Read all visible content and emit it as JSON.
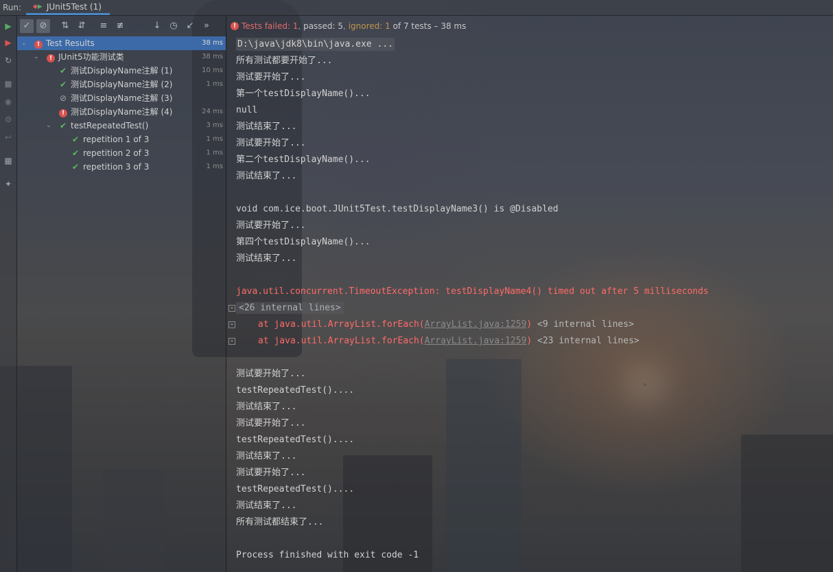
{
  "run_label": "Run:",
  "run_tab": {
    "label": "JUnit5Test (1)"
  },
  "status": {
    "failed": "Tests failed: 1",
    "passed": "passed: 5",
    "ignored": "ignored: 1",
    "summary": "of 7 tests – 38 ms"
  },
  "tree": [
    {
      "label": "Test Results",
      "duration": "38 ms",
      "status": "failed"
    },
    {
      "label": "JUnit5功能测试类",
      "duration": "38 ms",
      "status": "failed"
    },
    {
      "label": "测试DisplayName注解 (1)",
      "duration": "10 ms",
      "status": "passed"
    },
    {
      "label": "测试DisplayName注解 (2)",
      "duration": "1 ms",
      "status": "passed"
    },
    {
      "label": "测试DisplayName注解 (3)",
      "duration": "",
      "status": "ignored"
    },
    {
      "label": "测试DisplayName注解 (4)",
      "duration": "24 ms",
      "status": "failed"
    },
    {
      "label": "testRepeatedTest()",
      "duration": "3 ms",
      "status": "passed"
    },
    {
      "label": "repetition 1 of 3",
      "duration": "1 ms",
      "status": "passed"
    },
    {
      "label": "repetition 2 of 3",
      "duration": "1 ms",
      "status": "passed"
    },
    {
      "label": "repetition 3 of 3",
      "duration": "1 ms",
      "status": "passed"
    }
  ],
  "console": {
    "lines": [
      "D:\\java\\jdk8\\bin\\java.exe ...",
      "所有测试都要开始了...",
      "测试要开始了...",
      "第一个testDisplayName()...",
      "null",
      "测试结束了...",
      "测试要开始了...",
      "第二个testDisplayName()...",
      "测试结束了...",
      "",
      "void com.ice.boot.JUnit5Test.testDisplayName3() is @Disabled",
      "测试要开始了...",
      "第四个testDisplayName()...",
      "测试结束了...",
      "",
      "java.util.concurrent.TimeoutException: testDisplayName4() timed out after 5 milliseconds"
    ],
    "internal_lines": "<26 internal lines>",
    "trace": [
      {
        "prefix": "at java.util.ArrayList.forEach(",
        "link": "ArrayList.java:1259",
        "suffix": ")",
        "fold": "<9 internal lines>"
      },
      {
        "prefix": "at java.util.ArrayList.forEach(",
        "link": "ArrayList.java:1259",
        "suffix": ")",
        "fold": "<23 internal lines>"
      }
    ],
    "tail": [
      "",
      "测试要开始了...",
      "testRepeatedTest()....",
      "测试结束了...",
      "测试要开始了...",
      "testRepeatedTest()....",
      "测试结束了...",
      "测试要开始了...",
      "testRepeatedTest()....",
      "测试结束了...",
      "所有测试都结束了...",
      "",
      "Process finished with exit code -1"
    ]
  },
  "colors": {
    "accent": "#4a88c7",
    "passed": "#5fb85f",
    "failed": "#d9534f",
    "ignored_text": "#c0954a",
    "selection": "#3c6aa8"
  }
}
